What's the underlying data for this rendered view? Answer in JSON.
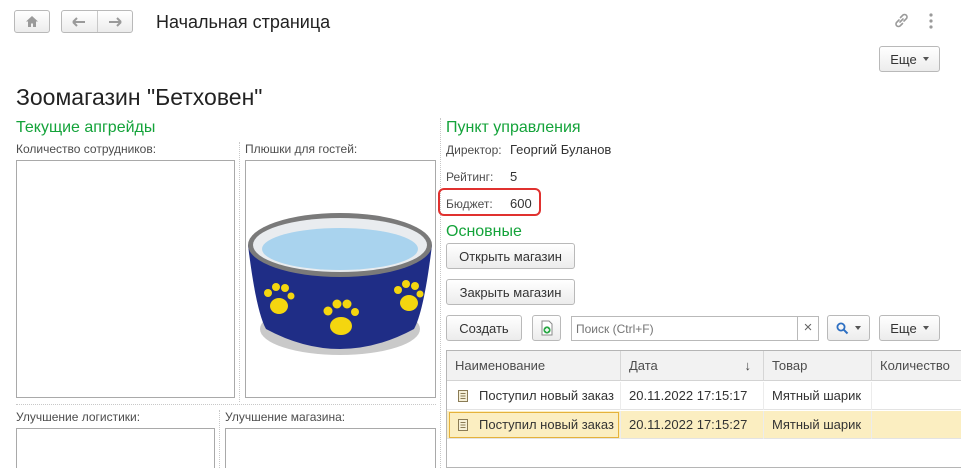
{
  "header": {
    "title": "Начальная страница",
    "more_label": "Еще"
  },
  "page_title": "Зоомагазин \"Бетховен\"",
  "upgrades": {
    "title": "Текущие апгрейды",
    "staff_label": "Количество сотрудников:",
    "treats_label": "Плюшки для гостей:",
    "logistics_label": "Улучшение логистики:",
    "store_label": "Улучшение магазина:"
  },
  "control": {
    "title": "Пункт управления",
    "director_label": "Директор:",
    "director_value": "Георгий Буланов",
    "rating_label": "Рейтинг:",
    "rating_value": "5",
    "budget_label": "Бюджет:",
    "budget_value": "600"
  },
  "main": {
    "title": "Основные",
    "open_store": "Открыть магазин",
    "close_store": "Закрыть магазин"
  },
  "list_toolbar": {
    "create": "Создать",
    "search_placeholder": "Поиск (Ctrl+F)",
    "clear": "×",
    "more": "Еще"
  },
  "table": {
    "columns": [
      "Наименование",
      "Дата",
      "Товар",
      "Количество"
    ],
    "sort_indicator": "↓",
    "rows": [
      {
        "name": "Поступил новый заказ",
        "date": "20.11.2022 17:15:17",
        "item": "Мятный шарик",
        "qty": ""
      },
      {
        "name": "Поступил новый заказ",
        "date": "20.11.2022 17:15:27",
        "item": "Мятный шарик",
        "qty": ""
      }
    ]
  },
  "colors": {
    "accent_green": "#14a33a",
    "highlight_red": "#e0312f",
    "selected_row": "#fbeec1",
    "bowl_blue": "#1f2d86",
    "paw_yellow": "#f4d60f"
  }
}
